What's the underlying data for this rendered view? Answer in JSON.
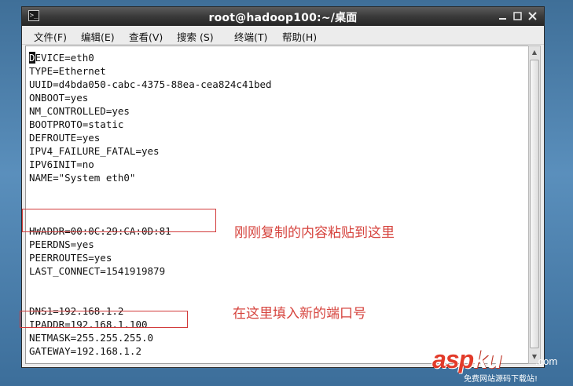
{
  "window": {
    "title": "root@hadoop100:~/桌面"
  },
  "menu": [
    {
      "label": "文件(F)"
    },
    {
      "label": "编辑(E)"
    },
    {
      "label": "查看(V)"
    },
    {
      "label": "搜索 (S)"
    },
    {
      "label": "终端(T)"
    },
    {
      "label": "帮助(H)"
    }
  ],
  "terminal": {
    "cursor_char": "D",
    "lines": [
      "EVICE=eth0",
      "TYPE=Ethernet",
      "UUID=d4bda050-cabc-4375-88ea-cea824c41bed",
      "ONBOOT=yes",
      "NM_CONTROLLED=yes",
      "BOOTPROTO=static",
      "DEFROUTE=yes",
      "IPV4_FAILURE_FATAL=yes",
      "IPV6INIT=no",
      "NAME=\"System eth0\"",
      "HWADDR=00:0C:29:CA:0D:81",
      "PEERDNS=yes",
      "PEERROUTES=yes",
      "LAST_CONNECT=1541919879",
      "DNS1=192.168.1.2",
      "IPADDR=192.168.1.100",
      "NETMASK=255.255.255.0",
      "GATEWAY=192.168.1.2"
    ]
  },
  "annotations": {
    "paste_note": "刚刚复制的内容粘贴到这里",
    "ip_note": "在这里填入新的端口号"
  },
  "watermark": {
    "brand_asp": "asp",
    "brand_ku": "ku",
    "brand_com": ".com",
    "tagline": "免费网站源码下载站!"
  },
  "colors": {
    "annotation_red": "#d6433d",
    "desktop_blue": "#4a7fab"
  }
}
